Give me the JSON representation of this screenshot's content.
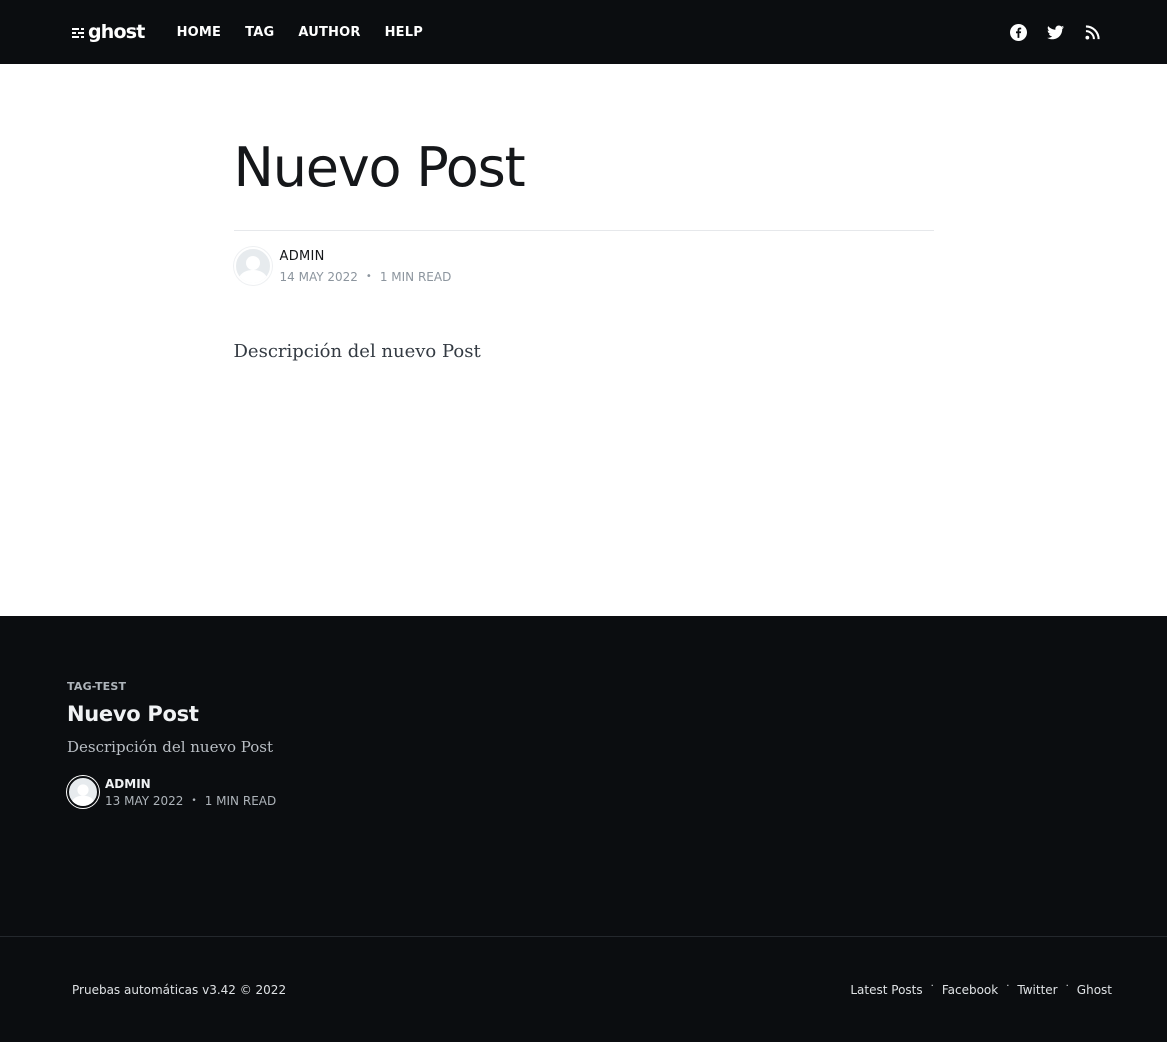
{
  "header": {
    "logo_text": "ghost",
    "nav": [
      {
        "label": "HOME"
      },
      {
        "label": "TAG"
      },
      {
        "label": "AUTHOR"
      },
      {
        "label": "HELP"
      }
    ],
    "social_icons": [
      "facebook-icon",
      "twitter-icon",
      "rss-icon"
    ]
  },
  "post": {
    "title": "Nuevo Post",
    "author": "ADMIN",
    "date": "14 MAY 2022",
    "reading_time": "1 MIN READ",
    "content": "Descripción del nuevo Post"
  },
  "read_next": {
    "tag": "TAG-TEST",
    "title": "Nuevo Post",
    "excerpt": "Descripción del nuevo Post",
    "author": "ADMIN",
    "date": "13 MAY 2022",
    "reading_time": "1 MIN READ"
  },
  "footer": {
    "copyright": "Pruebas automáticas v3.42 © 2022",
    "links": [
      {
        "label": "Latest Posts"
      },
      {
        "label": "Facebook"
      },
      {
        "label": "Twitter"
      },
      {
        "label": "Ghost"
      }
    ],
    "separator": "·"
  },
  "colors": {
    "header_bg": "#0b0d10",
    "footer_bg": "#0b0d10",
    "text": "#15171a",
    "meta": "#8c959e"
  }
}
